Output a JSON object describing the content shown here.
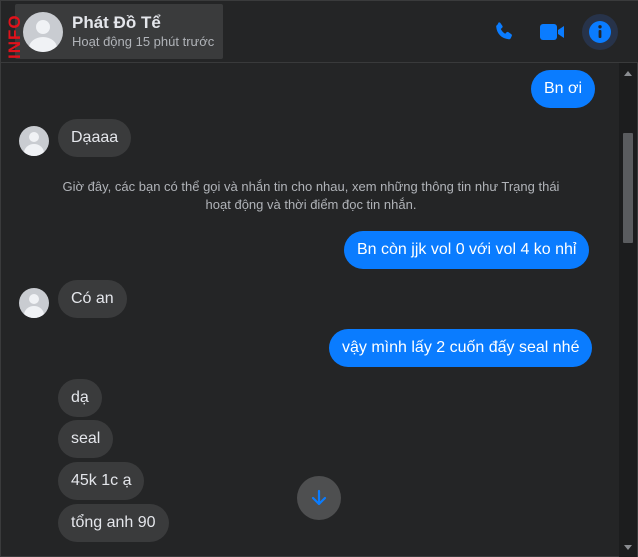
{
  "header": {
    "contact_name": "Phát Đồ Tể",
    "contact_status": "Hoạt động 15 phút trước",
    "watermark": "INFO",
    "icons": [
      "phone-icon",
      "video-camera-icon",
      "info-icon"
    ]
  },
  "colors": {
    "accent": "#0a7cff",
    "incoming_bubble": "#3a3b3c",
    "background": "#242526",
    "watermark": "#e0121b"
  },
  "messages": {
    "m1": "Bn ơi",
    "m2": "Dạaaa",
    "system_notice": "Giờ đây, các bạn có thể gọi và nhắn tin cho nhau, xem những thông tin như Trạng thái hoạt động và thời điểm đọc tin nhắn.",
    "m3": "Bn còn jjk vol 0 với vol 4 ko nhỉ",
    "m4": "Có an",
    "m5": "vậy mình lấy 2 cuốn đấy seal nhé",
    "m6": "dạ",
    "m7": "seal",
    "m8": "45k 1c ạ",
    "m9": "tổng anh 90"
  }
}
